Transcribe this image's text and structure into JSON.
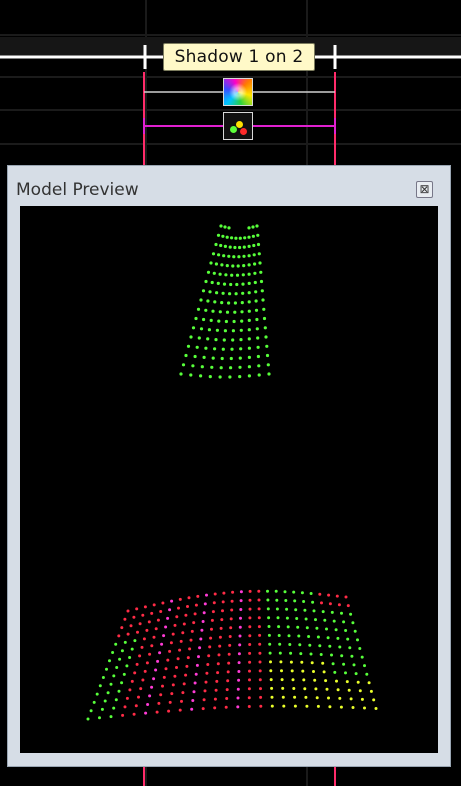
{
  "timeline": {
    "tooltip": "Shadow 1 on 2",
    "bar_color": "#ffffff",
    "range_line_color": "#ff2b6a",
    "magenta_bar_color": "#e020d0"
  },
  "effects": [
    {
      "icon": "shadow-effect-icon"
    },
    {
      "icon": "colored-dots-effect-icon"
    }
  ],
  "panel": {
    "title": "Model Preview",
    "close_label": "⊠"
  },
  "colors": {
    "green": "#57ff3a",
    "red": "#ff2b46",
    "magenta": "#ff3bd6",
    "yellow": "#eaff2a",
    "background": "#000000"
  }
}
